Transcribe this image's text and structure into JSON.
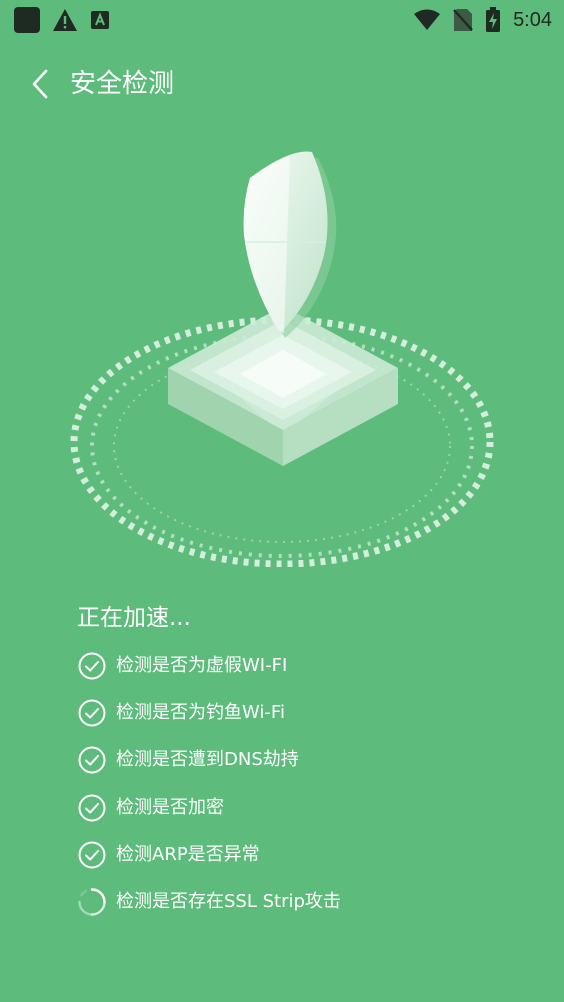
{
  "status_bar": {
    "time": "5:04",
    "left_icons": [
      "app-square-icon",
      "warning-icon",
      "a-badge-icon"
    ],
    "right_icons": [
      "wifi-icon",
      "no-sim-icon",
      "battery-icon"
    ]
  },
  "header": {
    "back_icon": "chevron-left-icon",
    "title": "安全检测"
  },
  "hero": {
    "icon": "shield-icon"
  },
  "scan": {
    "status_text": "正在加速...",
    "items": [
      {
        "label": "检测是否为虚假WI-FI",
        "state": "done",
        "icon": "check-circle-icon"
      },
      {
        "label": "检测是否为钓鱼Wi-Fi",
        "state": "done",
        "icon": "check-circle-icon"
      },
      {
        "label": "检测是否遭到DNS劫持",
        "state": "done",
        "icon": "check-circle-icon"
      },
      {
        "label": "检测是否加密",
        "state": "done",
        "icon": "check-circle-icon"
      },
      {
        "label": "检测ARP是否异常",
        "state": "done",
        "icon": "check-circle-icon"
      },
      {
        "label": "检测是否存在SSL Strip攻击",
        "state": "loading",
        "icon": "spinner-icon"
      }
    ]
  },
  "colors": {
    "background": "#5dbb7b",
    "foreground": "#ffffff",
    "status_icons": "#1f2a22"
  }
}
